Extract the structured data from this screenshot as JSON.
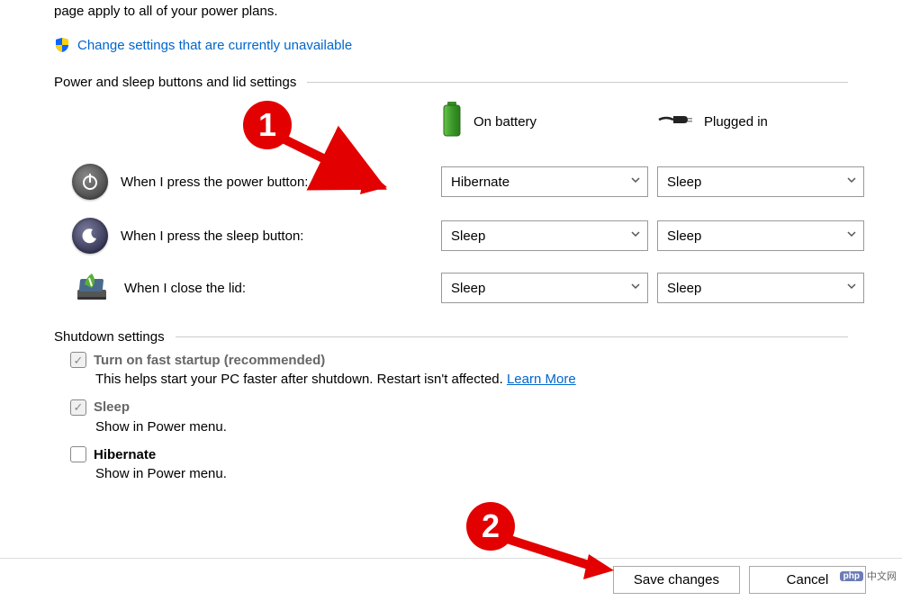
{
  "intro_text": "page apply to all of your power plans.",
  "admin_link": "Change settings that are currently unavailable",
  "section1_title": "Power and sleep buttons and lid settings",
  "column_headers": {
    "battery": "On battery",
    "plugged": "Plugged in"
  },
  "rows": {
    "power_button": {
      "label": "When I press the power button:",
      "battery_value": "Hibernate",
      "plugged_value": "Sleep"
    },
    "sleep_button": {
      "label": "When I press the sleep button:",
      "battery_value": "Sleep",
      "plugged_value": "Sleep"
    },
    "close_lid": {
      "label": "When I close the lid:",
      "battery_value": "Sleep",
      "plugged_value": "Sleep"
    }
  },
  "section2_title": "Shutdown settings",
  "shutdown": {
    "fast_startup": {
      "label": "Turn on fast startup (recommended)",
      "desc_a": "This helps start your PC faster after shutdown. Restart isn't affected. ",
      "learn_more": "Learn More",
      "checked": true
    },
    "sleep": {
      "label": "Sleep",
      "desc": "Show in Power menu.",
      "checked": true
    },
    "hibernate": {
      "label": "Hibernate",
      "desc": "Show in Power menu.",
      "checked": false
    }
  },
  "buttons": {
    "save": "Save changes",
    "cancel": "Cancel"
  },
  "annotations": {
    "badge1": "1",
    "badge2": "2"
  },
  "watermark": {
    "brand": "php",
    "text": "中文网"
  }
}
